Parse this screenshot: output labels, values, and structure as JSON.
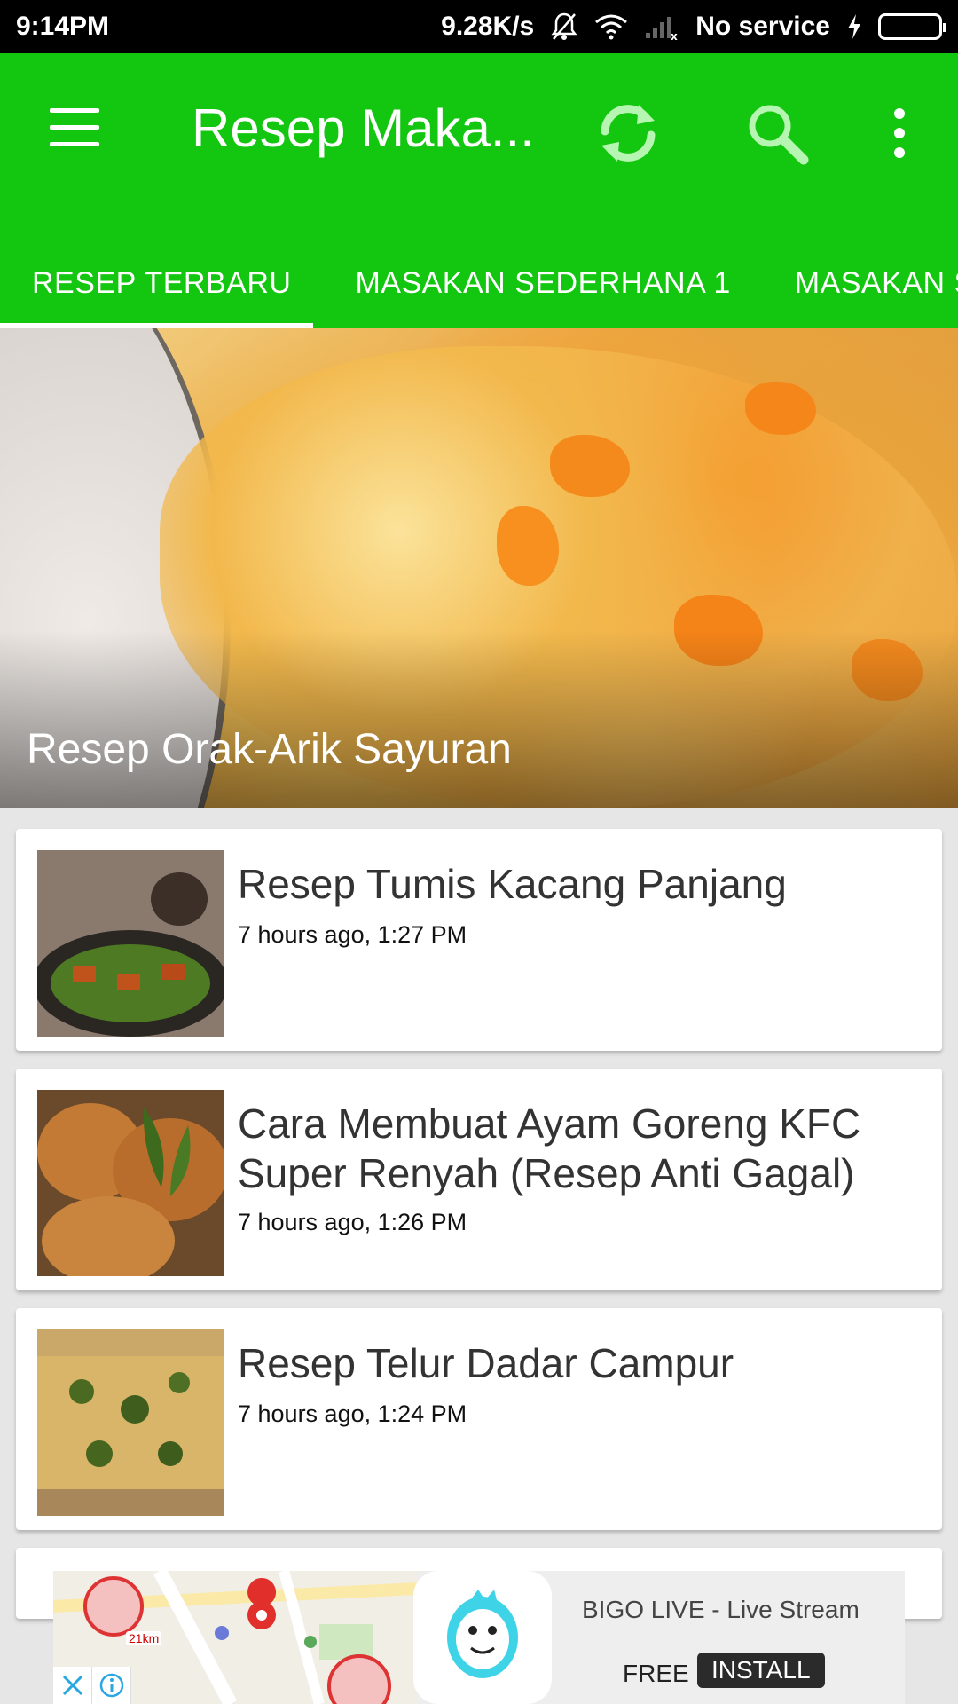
{
  "status_bar": {
    "time": "9:14PM",
    "speed": "9.28K/s",
    "network": "No service",
    "icons": [
      "mute-bell-icon",
      "wifi-icon",
      "signal-icon",
      "charging-icon",
      "battery-icon"
    ]
  },
  "toolbar": {
    "title": "Resep Maka...",
    "icons": [
      "menu-icon",
      "refresh-icon",
      "search-icon",
      "more-vert-icon"
    ]
  },
  "tabs": [
    {
      "label": "RESEP TERBARU"
    },
    {
      "label": "MASAKAN SEDERHANA 1"
    },
    {
      "label": "MASAKAN S"
    }
  ],
  "hero": {
    "title": "Resep Orak-Arik Sayuran"
  },
  "list": [
    {
      "title": "Resep Tumis Kacang Panjang",
      "time": "7 hours ago, 1:27 PM"
    },
    {
      "title": "Cara Membuat Ayam Goreng KFC Super Renyah (Resep Anti Gagal)",
      "time": "7 hours ago, 1:26 PM"
    },
    {
      "title": "Resep Telur Dadar Campur",
      "time": "7 hours ago, 1:24 PM"
    }
  ],
  "ad": {
    "title": "BIGO LIVE - Live Stream",
    "price": "FREE",
    "cta": "INSTALL",
    "map_label": "21km"
  },
  "colors": {
    "accent": "#13c60f",
    "status_bar": "#000000"
  }
}
